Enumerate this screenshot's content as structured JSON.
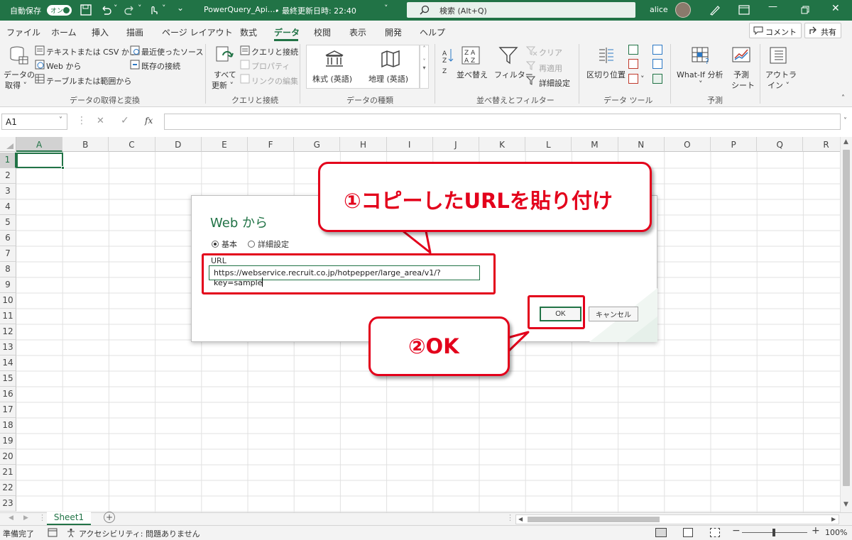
{
  "titlebar": {
    "autosave_label": "自動保存",
    "autosave_state": "オン",
    "filename": "PowerQuery_Api.…",
    "last_saved": "• 最終更新日時: 22:40",
    "search_placeholder": "検索 (Alt+Q)",
    "user": "alice"
  },
  "menu": {
    "items": [
      "ファイル",
      "ホーム",
      "挿入",
      "描画",
      "ページ レイアウト",
      "数式",
      "データ",
      "校閲",
      "表示",
      "開発",
      "ヘルプ"
    ],
    "comment_label": "コメント",
    "share_label": "共有"
  },
  "ribbon": {
    "get_data": {
      "big_label_1": "データの",
      "big_label_2": "取得 ˅",
      "items": [
        "テキストまたは CSV から",
        "Web から",
        "テーブルまたは範囲から",
        "最近使ったソース",
        "既存の接続"
      ],
      "group": "データの取得と変換"
    },
    "queries": {
      "big_label_1": "すべて",
      "big_label_2": "更新 ˅",
      "items": [
        "クエリと接続",
        "プロパティ",
        "リンクの編集"
      ],
      "group": "クエリと接続"
    },
    "datatypes": {
      "items": [
        "株式 (英語)",
        "地理 (英語)"
      ],
      "group": "データの種類"
    },
    "sort": {
      "sort_label": "並べ替え",
      "filter_label": "フィルター",
      "items": [
        "クリア",
        "再適用",
        "詳細設定"
      ],
      "group": "並べ替えとフィルター"
    },
    "tools": {
      "split_label": "区切り位置",
      "group": "データ ツール"
    },
    "forecast": {
      "whatif_label": "What-If 分析",
      "whatif_arrow": "˅",
      "sheet_label_1": "予測",
      "sheet_label_2": "シート",
      "group": "予測"
    },
    "outline": {
      "label_1": "アウトラ",
      "label_2": "イン ˅"
    }
  },
  "formula_bar": {
    "name_box": "A1",
    "fx": "fx"
  },
  "grid": {
    "columns": [
      "A",
      "B",
      "C",
      "D",
      "E",
      "F",
      "G",
      "H",
      "I",
      "J",
      "K",
      "L",
      "M",
      "N",
      "O",
      "P",
      "Q",
      "R"
    ],
    "rows": [
      "1",
      "2",
      "3",
      "4",
      "5",
      "6",
      "7",
      "8",
      "9",
      "10",
      "11",
      "12",
      "13",
      "14",
      "15",
      "16",
      "17",
      "18",
      "19",
      "20",
      "21",
      "22",
      "23"
    ]
  },
  "dialog": {
    "title": "Web から",
    "radio_basic": "基本",
    "radio_advanced": "詳細設定",
    "url_label": "URL",
    "url_value": "https://webservice.recruit.co.jp/hotpepper/large_area/v1/?key=sample",
    "ok_label": "OK",
    "cancel_label": "キャンセル"
  },
  "annotations": {
    "step1": "①コピーしたURLを貼り付け",
    "step2": "②OK",
    "color": "#e3001b"
  },
  "sheets": {
    "tab": "Sheet1",
    "add": "+"
  },
  "statusbar": {
    "ready": "準備完了",
    "accessibility": "アクセシビリティ: 問題ありません",
    "zoom": "100%"
  },
  "colors": {
    "accent": "#217346"
  }
}
